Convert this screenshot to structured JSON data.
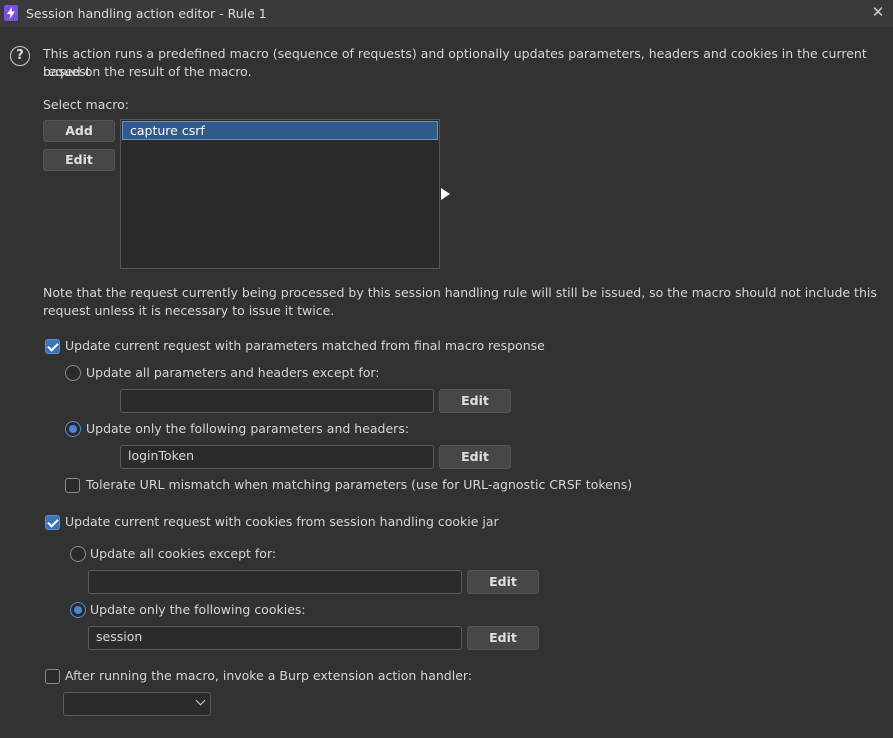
{
  "window": {
    "title": "Session handling action editor - Rule 1"
  },
  "intro": "This action runs a predefined macro (sequence of requests) and optionally updates parameters, headers and cookies in the current request",
  "intro2": "based on the result of the macro.",
  "macro": {
    "label": "Select macro:",
    "add_label": "Add",
    "edit_label": "Edit",
    "items": [
      "capture csrf"
    ]
  },
  "note": {
    "line1": "Note that the request currently being processed by this session handling rule will still be issued, so the macro should not include this",
    "line2": "request unless it is necessary to issue it twice."
  },
  "params": {
    "checkbox_label": "Update current request with parameters matched from final macro response",
    "checked": true,
    "except_label": "Update all parameters and headers except for:",
    "except_value": "",
    "only_label": "Update only the following parameters and headers:",
    "only_value": "loginToken",
    "selected": "only",
    "edit_label": "Edit",
    "tolerate_label": "Tolerate URL mismatch when matching parameters (use for URL-agnostic CRSF tokens)",
    "tolerate_checked": false
  },
  "cookies": {
    "checkbox_label": "Update current request with cookies from session handling cookie jar",
    "checked": true,
    "except_label": "Update all cookies except for:",
    "except_value": "",
    "only_label": "Update only the following cookies:",
    "only_value": "session",
    "selected": "only",
    "edit_label": "Edit"
  },
  "extension": {
    "checkbox_label": "After running the macro, invoke a Burp extension action handler:",
    "checked": false,
    "selected_handler": ""
  },
  "icons": {
    "app": "burp-lightning-icon",
    "close": "close-icon",
    "help": "help-icon"
  },
  "colors": {
    "accent": "#3d74b5",
    "selection": "#2f5a8a",
    "background": "#323232"
  }
}
